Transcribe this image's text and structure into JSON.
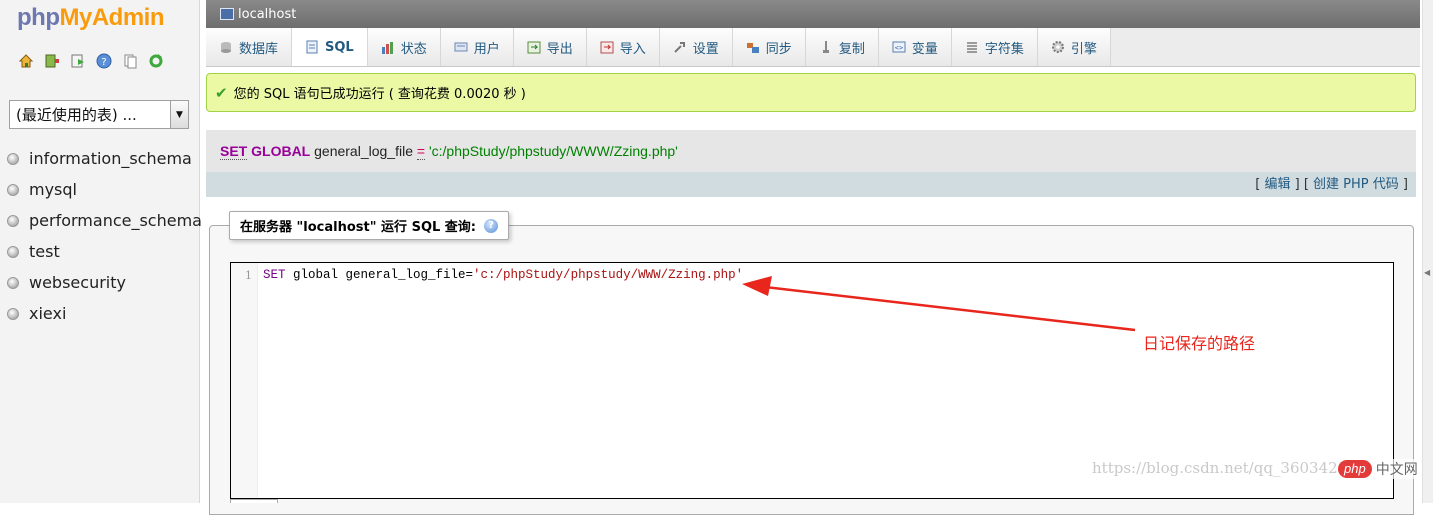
{
  "logo": {
    "part1": "php",
    "part2": "MyAdmin"
  },
  "nav_icons": [
    "home-icon",
    "exit-icon",
    "sql-window-icon",
    "help-icon",
    "docs-icon",
    "reload-icon"
  ],
  "db_select": {
    "value": "(最近使用的表) ..."
  },
  "databases": [
    "information_schema",
    "mysql",
    "performance_schema",
    "test",
    "websecurity",
    "xiexi"
  ],
  "server": {
    "name": "localhost"
  },
  "tabs": [
    {
      "label": "数据库",
      "icon": "database-icon"
    },
    {
      "label": "SQL",
      "icon": "sql-icon",
      "active": true
    },
    {
      "label": "状态",
      "icon": "status-icon"
    },
    {
      "label": "用户",
      "icon": "users-icon"
    },
    {
      "label": "导出",
      "icon": "export-icon"
    },
    {
      "label": "导入",
      "icon": "import-icon"
    },
    {
      "label": "设置",
      "icon": "settings-icon"
    },
    {
      "label": "同步",
      "icon": "sync-icon"
    },
    {
      "label": "复制",
      "icon": "replication-icon"
    },
    {
      "label": "变量",
      "icon": "variables-icon"
    },
    {
      "label": "字符集",
      "icon": "charset-icon"
    },
    {
      "label": "引擎",
      "icon": "engine-icon"
    }
  ],
  "success_message": "您的 SQL 语句已成功运行 ( 查询花费 0.0020 秒 )",
  "executed_sql": {
    "kw_set": "SET",
    "kw_global": "GLOBAL",
    "variable": "general_log_file",
    "operator": "=",
    "value": "'c:/phpStudy/phpstudy/WWW/Zzing.php'"
  },
  "edit_links": {
    "open": "[",
    "edit": "编辑",
    "sep": "] [",
    "create_php": "创建 PHP 代码",
    "close": "]"
  },
  "run_query_legend": "在服务器 \"localhost\" 运行 SQL 查询:",
  "editor": {
    "line_number": "1",
    "code_kw": "SET",
    "code_mid": " global general_log_file=",
    "code_str": "'c:/phpStudy/phpstudy/WWW/Zzing.php'"
  },
  "annotation": {
    "text": "日记保存的路径",
    "color": "#e8261c"
  },
  "watermark": "https://blog.csdn.net/qq_36034274",
  "badge": {
    "pill": "php",
    "text": "中文网"
  },
  "colors": {
    "link": "#235a81",
    "success_bg": "#ebf8a4",
    "success_border": "#a2d246",
    "logo_orange": "#f89c0e",
    "logo_blue": "#6c78af"
  }
}
